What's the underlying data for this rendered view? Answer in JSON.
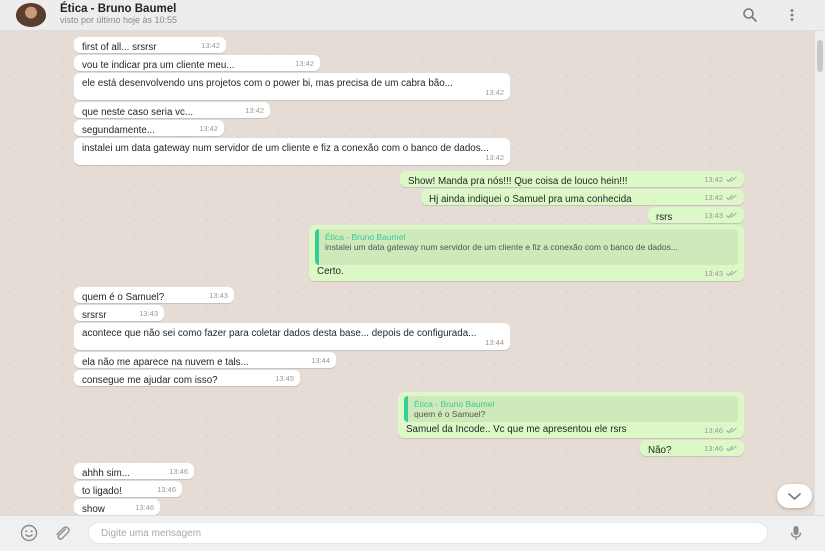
{
  "contact": {
    "name": "Ética - Bruno Baumel",
    "status": "visto por último hoje às 10:55"
  },
  "icons": {
    "search": "search-icon",
    "menu": "vertical-dots-icon",
    "emoji": "emoji-icon",
    "attach": "paperclip-icon",
    "mic": "microphone-icon",
    "scroll_down": "chevron-down-icon",
    "read": "double-check-icon"
  },
  "colors": {
    "incoming": "#ffffff",
    "outgoing": "#dcf8c6",
    "quote_accent": "#35cd96",
    "chat_bg": "#e5ddd5"
  },
  "messages": [
    {
      "dir": "in",
      "text": "first of all... srsrsr",
      "time": "13:42"
    },
    {
      "dir": "in",
      "text": "vou te indicar pra um cliente meu...",
      "time": "13:42"
    },
    {
      "dir": "in",
      "text": "ele está desenvolvendo uns projetos com o power bi, mas precisa de um cabra bão...",
      "time": "13:42"
    },
    {
      "dir": "in",
      "text": "que neste caso seria vc...",
      "time": "13:42"
    },
    {
      "dir": "in",
      "text": "segundamente...",
      "time": "13:42"
    },
    {
      "dir": "in",
      "text": "instalei um data gateway num servidor de um cliente e fiz a conexão com o banco de dados...",
      "time": "13:42"
    },
    {
      "dir": "out",
      "text": "Show! Manda pra nós!!! Que coisa de louco hein!!!",
      "time": "13:42"
    },
    {
      "dir": "out",
      "text": "Hj ainda indiquei o Samuel pra uma conhecida",
      "time": "13:42"
    },
    {
      "dir": "out",
      "text": "rsrs",
      "time": "13:43"
    },
    {
      "dir": "out",
      "text": "Certo.",
      "time": "13:43",
      "quote": {
        "name": "Ética - Bruno Baumel",
        "text": "instalei um data gateway num servidor de um cliente e fiz a conexão com o banco de dados..."
      }
    },
    {
      "dir": "in",
      "text": "quem é o Samuel?",
      "time": "13:43"
    },
    {
      "dir": "in",
      "text": "srsrsr",
      "time": "13:43"
    },
    {
      "dir": "in",
      "text": "acontece que não sei como fazer para coletar dados desta base... depois de configurada...",
      "time": "13:44"
    },
    {
      "dir": "in",
      "text": "ela não me aparece na nuvem e tals...",
      "time": "13:44"
    },
    {
      "dir": "in",
      "text": "consegue me ajudar com isso?",
      "time": "13:45"
    },
    {
      "dir": "out",
      "text": "Samuel da Incode.. Vc que me apresentou ele rsrs",
      "time": "13:46",
      "quote": {
        "name": "Ética - Bruno Baumel",
        "text": "quem é o Samuel?"
      }
    },
    {
      "dir": "out",
      "text": "Não?",
      "time": "13:46"
    },
    {
      "dir": "in",
      "text": "ahhh sim...",
      "time": "13:46"
    },
    {
      "dir": "in",
      "text": "to ligado!",
      "time": "13:46"
    },
    {
      "dir": "in",
      "text": "show",
      "time": "13:46"
    }
  ],
  "composer": {
    "placeholder": "Digite uma mensagem"
  }
}
